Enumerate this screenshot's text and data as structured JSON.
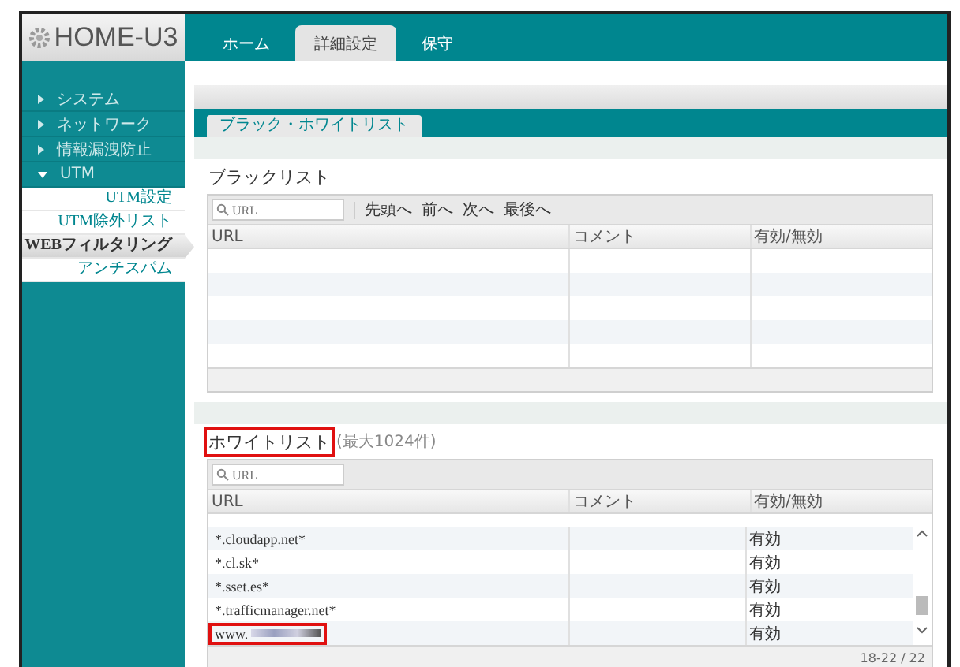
{
  "logo": "HOME-U3",
  "nav_tabs": [
    {
      "label": "ホーム",
      "selected": false
    },
    {
      "label": "詳細設定",
      "selected": true
    },
    {
      "label": "保守",
      "selected": false
    }
  ],
  "sidebar": {
    "items": [
      {
        "label": "システム",
        "expanded": false
      },
      {
        "label": "ネットワーク",
        "expanded": false
      },
      {
        "label": "情報漏洩防止",
        "expanded": false
      },
      {
        "label": "UTM",
        "expanded": true,
        "children": [
          {
            "label": "UTM設定",
            "selected": false
          },
          {
            "label": "UTM除外リスト",
            "selected": false
          },
          {
            "label": "WEBフィルタリング",
            "selected": true
          },
          {
            "label": "アンチスパム",
            "selected": false
          }
        ]
      }
    ]
  },
  "content_tabs": [
    {
      "label": "ブラック・ホワイトリスト",
      "selected": true
    }
  ],
  "blacklist": {
    "title": "ブラックリスト",
    "search": {
      "placeholder": "URL"
    },
    "pager": [
      "先頭へ",
      "前へ",
      "次へ",
      "最後へ"
    ],
    "columns": [
      "URL",
      "コメント",
      "有効/無効"
    ]
  },
  "whitelist": {
    "title": "ホワイトリスト",
    "title_highlighted": true,
    "note": "(最大1024件)",
    "search": {
      "placeholder": "URL"
    },
    "columns": [
      "URL",
      "コメント",
      "有効/無効"
    ],
    "rows": [
      {
        "url": "*.cloudapp.net*",
        "status": "有効",
        "highlighted": false,
        "redacted": false
      },
      {
        "url": "*.cl.sk*",
        "status": "有効",
        "highlighted": false,
        "redacted": false
      },
      {
        "url": "*.sset.es*",
        "status": "有効",
        "highlighted": false,
        "redacted": false
      },
      {
        "url": "*.trafficmanager.net*",
        "status": "有効",
        "highlighted": false,
        "redacted": false
      },
      {
        "url": "www.",
        "status": "有効",
        "highlighted": true,
        "redacted": true
      }
    ],
    "range": "18-22 / 22"
  }
}
